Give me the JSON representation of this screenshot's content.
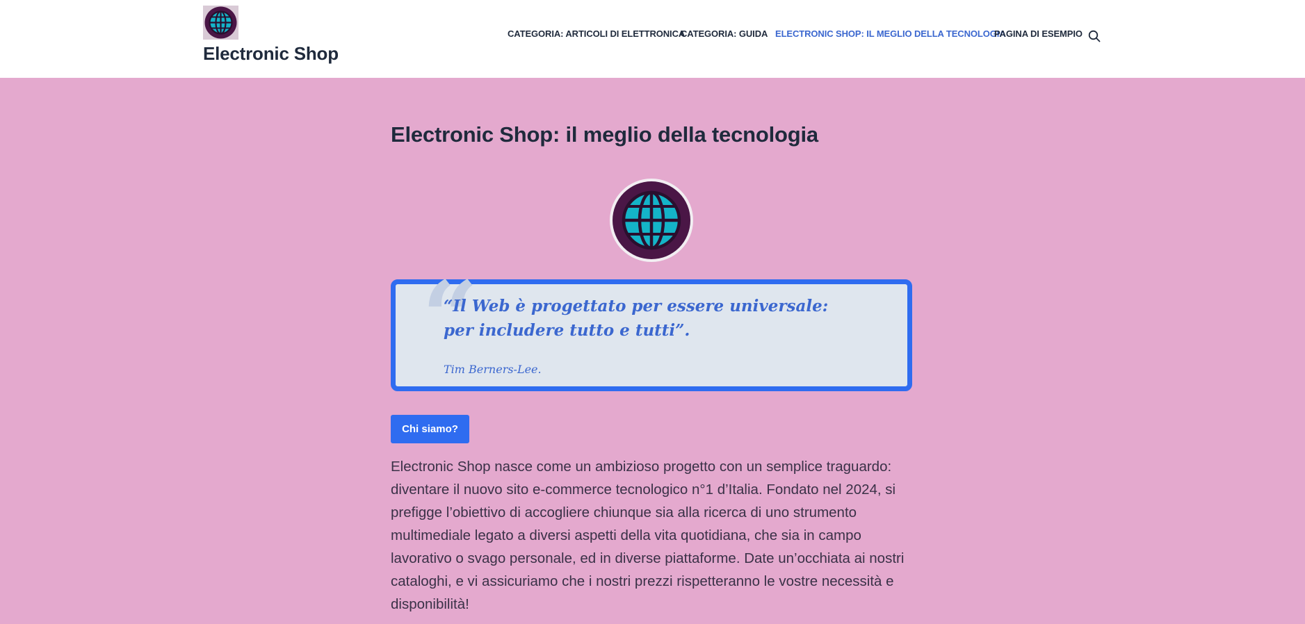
{
  "header": {
    "site_title": "Electronic Shop",
    "logo_icon": "globe-icon",
    "nav": [
      {
        "label": "CATEGORIA: ARTICOLI DI ELETTRONICA",
        "active": false
      },
      {
        "label": "CATEGORIA: GUIDA",
        "active": false
      },
      {
        "label": "ELECTRONIC SHOP: IL MEGLIO DELLA TECNOLOGIA",
        "active": true
      },
      {
        "label": "PAGINA DI ESEMPIO",
        "active": false
      }
    ],
    "search_icon": "search-icon"
  },
  "main": {
    "title": "Electronic Shop: il meglio della tecnologia",
    "quote": {
      "mark": "“",
      "text": "“Il Web è progettato per essere universale: per includere tutto e tutti”.",
      "cite": "Tim Berners-Lee."
    },
    "button_label": "Chi siamo?",
    "intro": "Electronic Shop nasce come un ambizioso progetto con un semplice traguardo: diventare il nuovo sito e-commerce tecnologico n°1 d’Italia. Fondato nel 2024, si prefigge l’obiettivo di accogliere chiunque sia alla ricerca di uno strumento multimediale legato a diversi aspetti della vita quotidiana, che sia in campo lavorativo o svago personale, ed in diverse piattaforme. Date un’occhiata ai nostri cataloghi, e vi assicuriamo che i nostri prezzi rispetteranno le vostre necessità e disponibilità!"
  },
  "colors": {
    "page_background": "#e4a9ce",
    "accent": "#2f6cf0",
    "link_active": "#3b67cf",
    "text_dark": "#1f2a3c",
    "globe": "#14b4c8",
    "globe_frame": "#4a1646"
  }
}
